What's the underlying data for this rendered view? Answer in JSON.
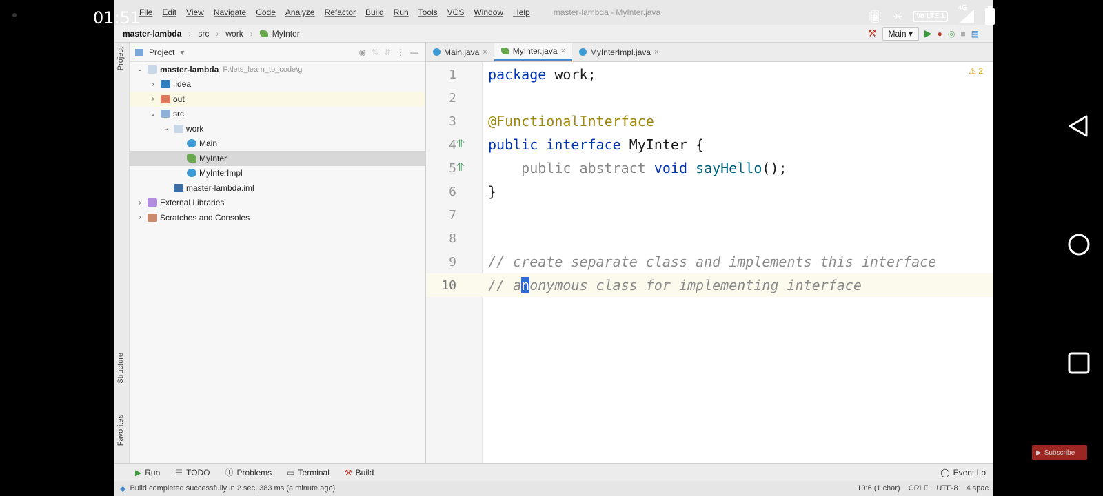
{
  "phone": {
    "time": "01:51",
    "network": "4G",
    "lte_badge": "Vo LTE 1"
  },
  "menu": {
    "items": [
      "File",
      "Edit",
      "View",
      "Navigate",
      "Code",
      "Analyze",
      "Refactor",
      "Build",
      "Run",
      "Tools",
      "VCS",
      "Window",
      "Help"
    ],
    "window_title": "master-lambda - MyInter.java"
  },
  "breadcrumb": {
    "project": "master-lambda",
    "folder1": "src",
    "folder2": "work",
    "file": "MyInter"
  },
  "run_config": "Main",
  "project_panel": {
    "title": "Project",
    "tree": [
      {
        "label": "master-lambda",
        "path": "F:\\lets_learn_to_code\\g",
        "level": 0,
        "expanded": true,
        "icon": "folder"
      },
      {
        "label": ".idea",
        "level": 1,
        "expanded": false,
        "icon": "folder-idea"
      },
      {
        "label": "out",
        "level": 1,
        "expanded": false,
        "icon": "folder-out"
      },
      {
        "label": "src",
        "level": 1,
        "expanded": true,
        "icon": "folder-src"
      },
      {
        "label": "work",
        "level": 2,
        "expanded": true,
        "icon": "package"
      },
      {
        "label": "Main",
        "level": 3,
        "icon": "class"
      },
      {
        "label": "MyInter",
        "level": 3,
        "icon": "interface"
      },
      {
        "label": "MyInterImpl",
        "level": 3,
        "icon": "class"
      },
      {
        "label": "master-lambda.iml",
        "level": 2,
        "icon": "iml"
      },
      {
        "label": "External Libraries",
        "level": 0,
        "expanded": false,
        "icon": "library"
      },
      {
        "label": "Scratches and Consoles",
        "level": 0,
        "expanded": false,
        "icon": "scratch"
      }
    ]
  },
  "tabs": [
    {
      "label": "Main.java",
      "icon": "class",
      "active": false
    },
    {
      "label": "MyInter.java",
      "icon": "interface",
      "active": true
    },
    {
      "label": "MyInterImpl.java",
      "icon": "class",
      "active": false
    }
  ],
  "editor": {
    "warning_count": "2",
    "lines": [
      {
        "n": "1",
        "parts": [
          [
            "kw",
            "package"
          ],
          [
            "plain",
            " work;"
          ]
        ]
      },
      {
        "n": "2",
        "parts": []
      },
      {
        "n": "3",
        "parts": [
          [
            "ann",
            "@FunctionalInterface"
          ]
        ]
      },
      {
        "n": "4",
        "parts": [
          [
            "kw",
            "public interface"
          ],
          [
            "plain",
            " MyInter {"
          ]
        ]
      },
      {
        "n": "5",
        "parts": [
          [
            "gray",
            "    public abstract "
          ],
          [
            "kw",
            "void"
          ],
          [
            "plain",
            " "
          ],
          [
            "fn",
            "sayHello"
          ],
          [
            "plain",
            "();"
          ]
        ]
      },
      {
        "n": "6",
        "parts": [
          [
            "plain",
            "}"
          ]
        ]
      },
      {
        "n": "7",
        "parts": []
      },
      {
        "n": "8",
        "parts": []
      },
      {
        "n": "9",
        "parts": [
          [
            "cmt",
            "// create separate class and implements this interface"
          ]
        ]
      },
      {
        "n": "10",
        "parts": [
          [
            "cmt",
            "// a"
          ],
          [
            "caret",
            "n"
          ],
          [
            "cmt",
            "onymous class for implementing interface"
          ]
        ]
      }
    ]
  },
  "side_labels": {
    "project": "Project",
    "structure": "Structure",
    "favorites": "Favorites"
  },
  "tool_windows": [
    "Run",
    "TODO",
    "Problems",
    "Terminal",
    "Build"
  ],
  "event_log": "Event Lo",
  "status": {
    "message": "Build completed successfully in 2 sec, 383 ms (a minute ago)",
    "position": "10:6 (1 char)",
    "line_sep": "CRLF",
    "encoding": "UTF-8",
    "indent": "4 spac"
  },
  "subscribe": "Subscribe"
}
